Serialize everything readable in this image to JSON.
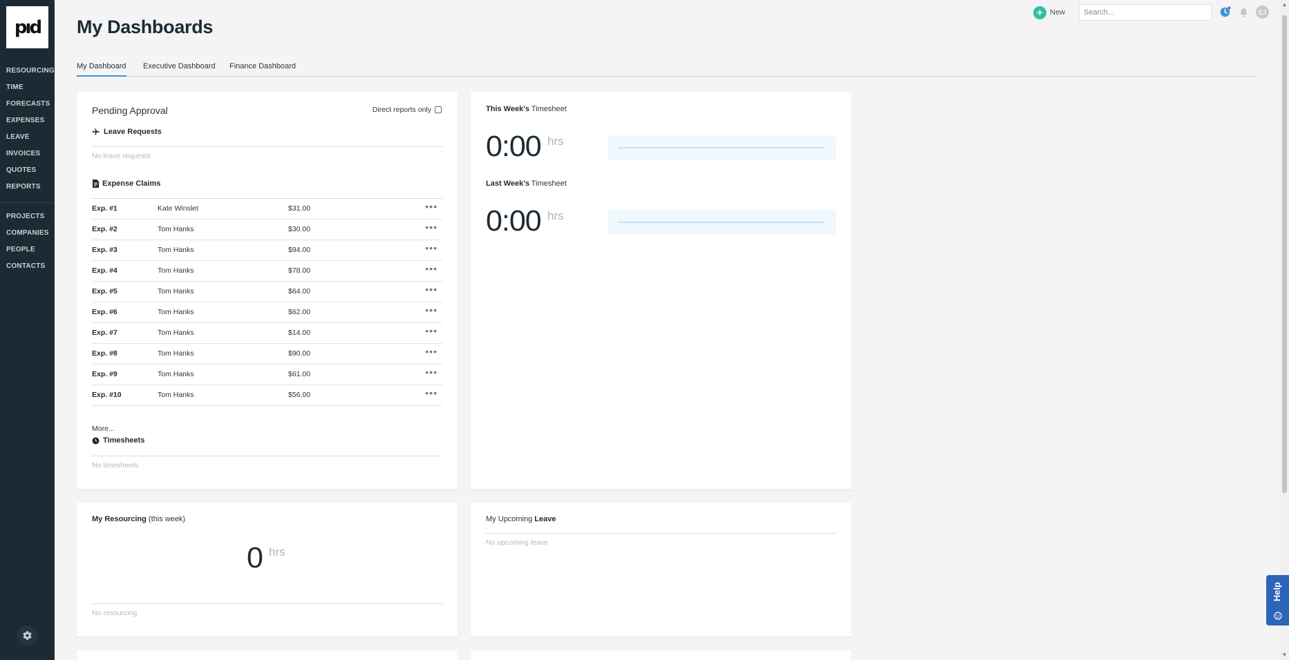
{
  "sidebar": {
    "logo_text": "pıd",
    "nav_primary": [
      "RESOURCING",
      "TIME",
      "FORECASTS",
      "EXPENSES",
      "LEAVE",
      "INVOICES",
      "QUOTES",
      "REPORTS"
    ],
    "nav_secondary": [
      "PROJECTS",
      "COMPANIES",
      "PEOPLE",
      "CONTACTS"
    ],
    "settings_icon": "gear-icon"
  },
  "topbar": {
    "new_label": "New",
    "search_placeholder": "Search...",
    "avatar_initials": "CJ",
    "accent": "#2fbfa0"
  },
  "page": {
    "title": "My Dashboards",
    "tabs": [
      "My Dashboard",
      "Executive Dashboard",
      "Finance Dashboard"
    ],
    "active_tab": "My Dashboard"
  },
  "pending": {
    "title": "Pending Approval",
    "direct_reports_label": "Direct reports only",
    "leave_title": "Leave Requests",
    "leave_empty": "No leave requests",
    "expense_title": "Expense Claims",
    "expenses": [
      {
        "id": "Exp. #1",
        "name": "Kate Winslet",
        "amount": "$31.00"
      },
      {
        "id": "Exp. #2",
        "name": "Tom Hanks",
        "amount": "$30.00"
      },
      {
        "id": "Exp. #3",
        "name": "Tom Hanks",
        "amount": "$94.00"
      },
      {
        "id": "Exp. #4",
        "name": "Tom Hanks",
        "amount": "$78.00"
      },
      {
        "id": "Exp. #5",
        "name": "Tom Hanks",
        "amount": "$64.00"
      },
      {
        "id": "Exp. #6",
        "name": "Tom Hanks",
        "amount": "$62.00"
      },
      {
        "id": "Exp. #7",
        "name": "Tom Hanks",
        "amount": "$14.00"
      },
      {
        "id": "Exp. #8",
        "name": "Tom Hanks",
        "amount": "$90.00"
      },
      {
        "id": "Exp. #9",
        "name": "Tom Hanks",
        "amount": "$61.00"
      },
      {
        "id": "Exp. #10",
        "name": "Tom Hanks",
        "amount": "$56.00"
      }
    ],
    "more_label": "More...",
    "timesheets_title": "Timesheets",
    "timesheets_empty": "No timesheets"
  },
  "timesheet": {
    "this_week_bold": "This Week's",
    "this_week_rest": " Timesheet",
    "this_week_value": "0:00",
    "last_week_bold": "Last Week's",
    "last_week_rest": " Timesheet",
    "last_week_value": "0:00",
    "unit": "hrs"
  },
  "resourcing": {
    "title_bold": "My Resourcing",
    "title_rest": " (this week)",
    "value": "0",
    "unit": "hrs",
    "empty": "No resourcing"
  },
  "leave": {
    "title_rest": "My Upcoming ",
    "title_bold": "Leave",
    "empty": "No upcoming leave"
  },
  "help_label": "Help"
}
